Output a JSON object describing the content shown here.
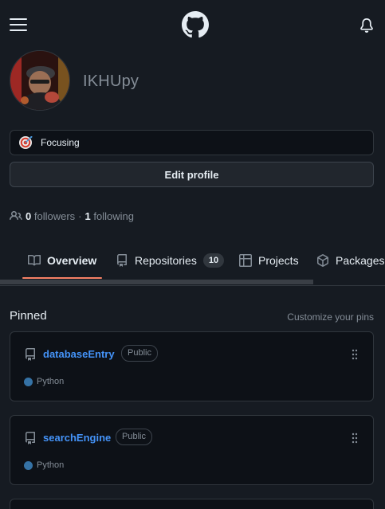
{
  "header": {
    "menu_icon": "hamburger-menu-icon",
    "logo_icon": "github-mark-icon",
    "notification_icon": "bell-icon"
  },
  "profile": {
    "username": "IKHUpy",
    "status": {
      "emoji": "dart-emoji",
      "text": "Focusing"
    },
    "edit_button": "Edit profile",
    "followers_count": "0",
    "followers_label": "followers",
    "separator": "·",
    "following_count": "1",
    "following_label": "following"
  },
  "tabs": [
    {
      "label": "Overview",
      "icon": "book-icon",
      "active": true
    },
    {
      "label": "Repositories",
      "icon": "repo-icon",
      "counter": "10"
    },
    {
      "label": "Projects",
      "icon": "table-icon"
    },
    {
      "label": "Packages",
      "icon": "package-icon"
    }
  ],
  "pinned": {
    "title": "Pinned",
    "customize_label": "Customize your pins",
    "cards": [
      {
        "name": "databaseEntry",
        "visibility": "Public",
        "language": "Python",
        "language_color": "#3572A5"
      },
      {
        "name": "searchEngine",
        "visibility": "Public",
        "language": "Python",
        "language_color": "#3572A5"
      }
    ]
  },
  "colors": {
    "accent_link": "#4493f8",
    "tab_underline": "#f78166",
    "background": "#161b22"
  }
}
